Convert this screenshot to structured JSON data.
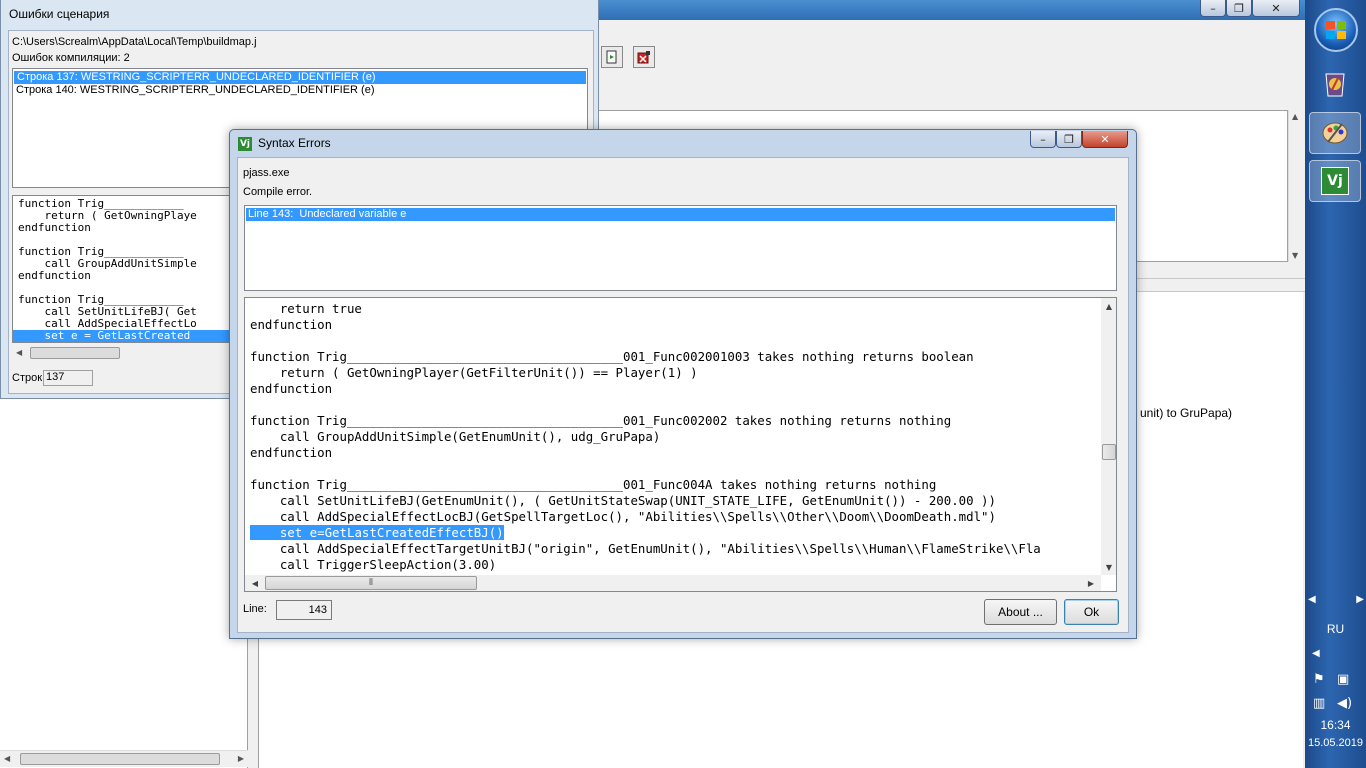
{
  "background_app": {
    "visible_text": "d unit) to GruPapa)",
    "caption_buttons": [
      "–",
      "❐",
      "✕"
    ]
  },
  "compile_errors_window": {
    "title": "Ошибки сценария",
    "file_path": "C:\\Users\\Screalm\\AppData\\Local\\Temp\\buildmap.j",
    "error_count_label": "Ошибок компиляции: 2",
    "errors": [
      {
        "text": "Строка 137: WESTRING_SCRIPTERR_UNDECLARED_IDENTIFIER (e)",
        "selected": true
      },
      {
        "text": "Строка 140: WESTRING_SCRIPTERR_UNDECLARED_IDENTIFIER (e)",
        "selected": false
      }
    ],
    "code_lines": [
      "function Trig____________",
      "    return ( GetOwningPlaye",
      "endfunction",
      "",
      "function Trig____________",
      "    call GroupAddUnitSimple",
      "endfunction",
      "",
      "function Trig____________",
      "    call SetUnitLifeBJ( Get",
      "    call AddSpecialEffectLo",
      "    set e = GetLastCreated"
    ],
    "selected_code_line": 11,
    "line_label": "Строк",
    "line_value": "137"
  },
  "syntax_errors_window": {
    "title": "Syntax Errors",
    "icon_text": "Vj",
    "exe_name": "pjass.exe",
    "compile_status": "Compile error.",
    "errors": [
      {
        "text": "Line 143:  Undeclared variable e",
        "selected": true
      }
    ],
    "code_lines": [
      {
        "text": "    return true"
      },
      {
        "text": "endfunction"
      },
      {
        "text": ""
      },
      {
        "text": "function Trig_____________________________________001_Func002001003 takes nothing returns boolean"
      },
      {
        "text": "    return ( GetOwningPlayer(GetFilterUnit()) == Player(1) )"
      },
      {
        "text": "endfunction"
      },
      {
        "text": ""
      },
      {
        "text": "function Trig_____________________________________001_Func002002 takes nothing returns nothing"
      },
      {
        "text": "    call GroupAddUnitSimple(GetEnumUnit(), udg_GruPapa)"
      },
      {
        "text": "endfunction"
      },
      {
        "text": ""
      },
      {
        "text": "function Trig_____________________________________001_Func004A takes nothing returns nothing"
      },
      {
        "text": "    call SetUnitLifeBJ(GetEnumUnit(), ( GetUnitStateSwap(UNIT_STATE_LIFE, GetEnumUnit()) - 200.00 ))"
      },
      {
        "text": "    call AddSpecialEffectLocBJ(GetSpellTargetLoc(), \"Abilities\\\\Spells\\\\Other\\\\Doom\\\\DoomDeath.mdl\")"
      },
      {
        "text": "set e=GetLastCreatedEffectBJ()",
        "indent": "    ",
        "highlighted": true
      },
      {
        "text": "    call AddSpecialEffectTargetUnitBJ(\"origin\", GetEnumUnit(), \"Abilities\\\\Spells\\\\Human\\\\FlameStrike\\\\Fla"
      },
      {
        "text": "    call TriggerSleepAction(3.00)"
      }
    ],
    "line_label": "Line:",
    "line_value": "143",
    "about_button": "About ...",
    "ok_button": "Ok",
    "min_button": "–",
    "max_button": "❐",
    "close_button": "✕"
  },
  "taskbar": {
    "language": "RU",
    "time": "16:34",
    "date": "15.05.2019"
  },
  "colors": {
    "selection": "#3399ff",
    "taskbar": "#2d66b0",
    "window_frame": "#c6d6ea"
  }
}
